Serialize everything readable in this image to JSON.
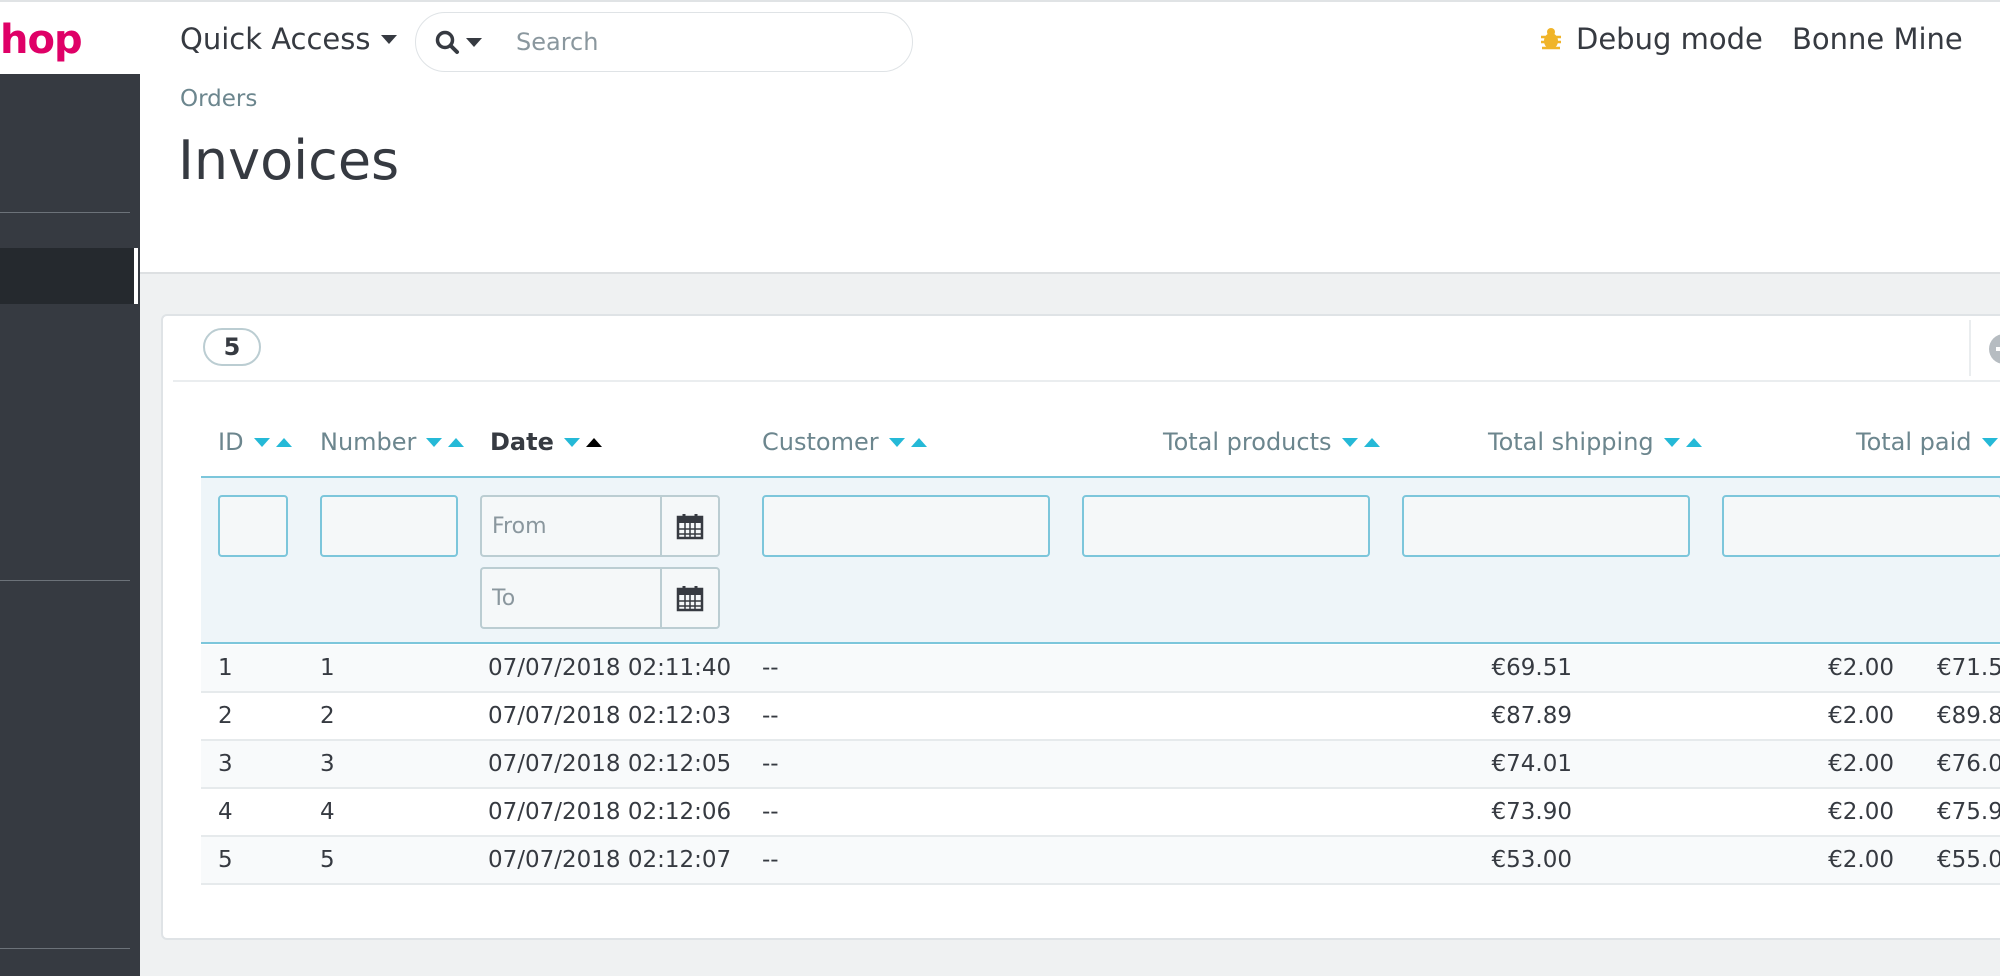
{
  "header": {
    "logo_text": "hop",
    "quick_access_label": "Quick Access",
    "search": {
      "placeholder": "Search"
    },
    "debug_label": "Debug mode",
    "user_name": "Bonne Mine"
  },
  "breadcrumb": "Orders",
  "page_title": "Invoices",
  "list": {
    "count": "5",
    "columns": {
      "id": "ID",
      "number": "Number",
      "date": "Date",
      "customer": "Customer",
      "total_products": "Total products",
      "total_shipping": "Total shipping",
      "total_paid": "Total paid"
    },
    "filters": {
      "date_from_placeholder": "From",
      "date_to_placeholder": "To"
    },
    "rows": [
      {
        "id": "1",
        "number": "1",
        "date": "07/07/2018 02:11:40",
        "customer": "--",
        "total_products": "€69.51",
        "total_shipping": "€2.00",
        "total_paid": "€71.5"
      },
      {
        "id": "2",
        "number": "2",
        "date": "07/07/2018 02:12:03",
        "customer": "--",
        "total_products": "€87.89",
        "total_shipping": "€2.00",
        "total_paid": "€89.8"
      },
      {
        "id": "3",
        "number": "3",
        "date": "07/07/2018 02:12:05",
        "customer": "--",
        "total_products": "€74.01",
        "total_shipping": "€2.00",
        "total_paid": "€76.0"
      },
      {
        "id": "4",
        "number": "4",
        "date": "07/07/2018 02:12:06",
        "customer": "--",
        "total_products": "€73.90",
        "total_shipping": "€2.00",
        "total_paid": "€75.9"
      },
      {
        "id": "5",
        "number": "5",
        "date": "07/07/2018 02:12:07",
        "customer": "--",
        "total_products": "€53.00",
        "total_shipping": "€2.00",
        "total_paid": "€55.0"
      }
    ]
  },
  "icons": {
    "search": "search-icon",
    "debug": "bug-icon",
    "calendar": "calendar-icon",
    "add": "add-circle-icon",
    "sort_desc": "sort-desc-icon",
    "sort_asc": "sort-asc-icon"
  },
  "colors": {
    "brand": "#df0067",
    "accent": "#25b9d7",
    "sidebar": "#363a41",
    "debug_icon": "#f0b429"
  }
}
